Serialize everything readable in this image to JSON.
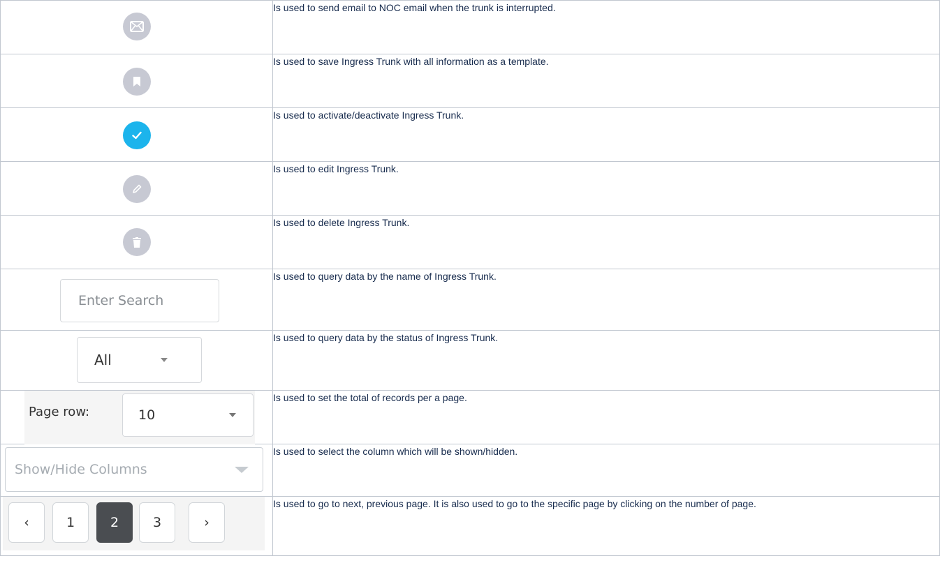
{
  "rows": [
    {
      "icon": "email-icon",
      "description": "Is used to send email to NOC email when the trunk is interrupted."
    },
    {
      "icon": "bookmark-icon",
      "description": "Is used to save Ingress Trunk with all information as a template."
    },
    {
      "icon": "check-icon",
      "description": "Is used to activate/deactivate Ingress Trunk."
    },
    {
      "icon": "pencil-icon",
      "description": "Is used to edit Ingress Trunk."
    },
    {
      "icon": "trash-icon",
      "description": "Is used to delete Ingress Trunk."
    },
    {
      "icon": "",
      "description": "Is used to query data by the name of Ingress Trunk."
    },
    {
      "icon": "",
      "description": "Is used to query data by the status of Ingress Trunk."
    },
    {
      "icon": "",
      "description": "Is used to set the total of records per a page."
    },
    {
      "icon": "",
      "description": "Is used to select the column which will be shown/hidden."
    },
    {
      "icon": "",
      "description": "Is used to go to next, previous page. It is also used to go to the specific page by clicking on the number of page."
    }
  ],
  "search": {
    "placeholder": "Enter Search"
  },
  "status_filter": {
    "value": "All"
  },
  "page_row": {
    "label": "Page row:",
    "value": "10"
  },
  "columns_toggle": {
    "placeholder": "Show/Hide Columns"
  },
  "pagination": {
    "prev": "‹",
    "pages": [
      "1",
      "2",
      "3"
    ],
    "active_page": "2",
    "next": "›"
  },
  "colors": {
    "icon_gray": "#c7c9d3",
    "icon_blue": "#1cb4ec",
    "active_page_bg": "#4a4d51"
  }
}
